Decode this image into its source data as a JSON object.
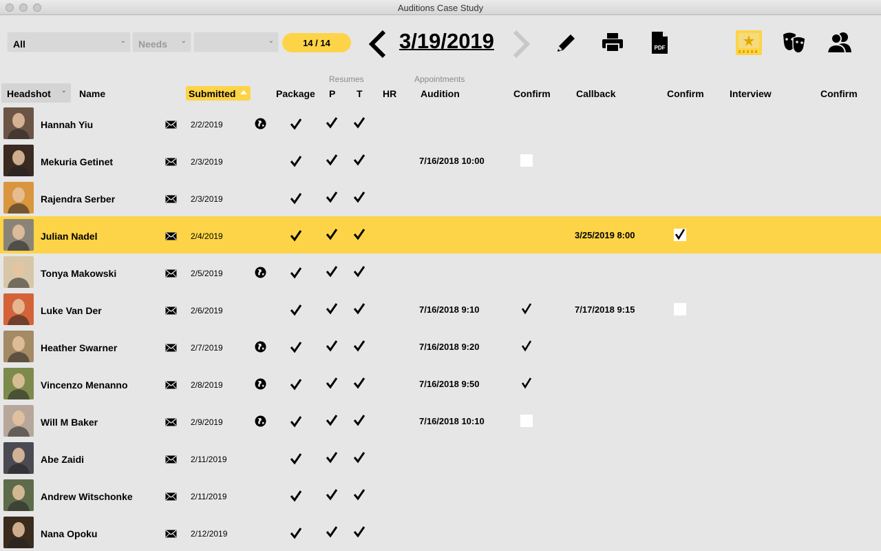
{
  "window": {
    "title": "Auditions Case Study"
  },
  "toolbar": {
    "filter_all": "All",
    "filter_needs": "Needs",
    "filter_third": "",
    "record_count": "14 / 14",
    "current_date": "3/19/2019",
    "icons": [
      "prev-arrow-icon",
      "next-arrow-icon",
      "pencil-icon",
      "printer-icon",
      "pdf-icon",
      "star-stage-icon",
      "theater-masks-icon",
      "people-icon"
    ],
    "accent_color": "#fdd447"
  },
  "headers": {
    "group_resumes": "Resumes",
    "group_appointments": "Appointments",
    "headshot": "Headshot",
    "name": "Name",
    "submitted": "Submitted",
    "package": "Package",
    "p": "P",
    "t": "T",
    "hr": "HR",
    "audition": "Audition",
    "confirm1": "Confirm",
    "callback": "Callback",
    "confirm2": "Confirm",
    "interview": "Interview",
    "confirm3": "Confirm"
  },
  "rows": [
    {
      "name": "Hannah Yiu",
      "submitted": "2/2/2019",
      "web": true,
      "package": true,
      "p": true,
      "t": true,
      "audition": "",
      "audition_confirm": null,
      "callback": "",
      "callback_confirm": null,
      "selected": false,
      "avatar_color": "#6b5446"
    },
    {
      "name": "Mekuria Getinet",
      "submitted": "2/3/2019",
      "web": false,
      "package": true,
      "p": true,
      "t": true,
      "audition": "7/16/2018 10:00",
      "audition_confirm": false,
      "callback": "",
      "callback_confirm": null,
      "selected": false,
      "avatar_color": "#3a2a22"
    },
    {
      "name": "Rajendra Serber",
      "submitted": "2/3/2019",
      "web": false,
      "package": true,
      "p": true,
      "t": true,
      "audition": "",
      "audition_confirm": null,
      "callback": "",
      "callback_confirm": null,
      "selected": false,
      "avatar_color": "#d9963f"
    },
    {
      "name": "Julian Nadel",
      "submitted": "2/4/2019",
      "web": false,
      "package": true,
      "p": true,
      "t": true,
      "audition": "",
      "audition_confirm": null,
      "callback": "3/25/2019 8:00",
      "callback_confirm": true,
      "selected": true,
      "avatar_color": "#8a8478"
    },
    {
      "name": "Tonya Makowski",
      "submitted": "2/5/2019",
      "web": true,
      "package": true,
      "p": true,
      "t": true,
      "audition": "",
      "audition_confirm": null,
      "callback": "",
      "callback_confirm": null,
      "selected": false,
      "avatar_color": "#d7c7a8"
    },
    {
      "name": "Luke Van Der",
      "submitted": "2/6/2019",
      "web": false,
      "package": true,
      "p": true,
      "t": true,
      "audition": "7/16/2018 9:10",
      "audition_confirm": true,
      "callback": "7/17/2018 9:15",
      "callback_confirm": false,
      "selected": false,
      "avatar_color": "#d5633a"
    },
    {
      "name": "Heather Swarner",
      "submitted": "2/7/2019",
      "web": true,
      "package": true,
      "p": true,
      "t": true,
      "audition": "7/16/2018 9:20",
      "audition_confirm": true,
      "callback": "",
      "callback_confirm": null,
      "selected": false,
      "avatar_color": "#a58a66"
    },
    {
      "name": "Vincenzo Menanno",
      "submitted": "2/8/2019",
      "web": true,
      "package": true,
      "p": true,
      "t": true,
      "audition": "7/16/2018 9:50",
      "audition_confirm": true,
      "callback": "",
      "callback_confirm": null,
      "selected": false,
      "avatar_color": "#7c8a4c"
    },
    {
      "name": "Will M Baker",
      "submitted": "2/9/2019",
      "web": true,
      "package": true,
      "p": true,
      "t": true,
      "audition": "7/16/2018 10:10",
      "audition_confirm": false,
      "callback": "",
      "callback_confirm": null,
      "selected": false,
      "avatar_color": "#b7a79a"
    },
    {
      "name": "Abe Zaidi",
      "submitted": "2/11/2019",
      "web": false,
      "package": true,
      "p": true,
      "t": true,
      "audition": "",
      "audition_confirm": null,
      "callback": "",
      "callback_confirm": null,
      "selected": false,
      "avatar_color": "#4a4a52"
    },
    {
      "name": "Andrew Witschonke",
      "submitted": "2/11/2019",
      "web": false,
      "package": true,
      "p": true,
      "t": true,
      "audition": "",
      "audition_confirm": null,
      "callback": "",
      "callback_confirm": null,
      "selected": false,
      "avatar_color": "#5d6b4a"
    },
    {
      "name": "Nana Opoku",
      "submitted": "2/12/2019",
      "web": false,
      "package": true,
      "p": true,
      "t": true,
      "audition": "",
      "audition_confirm": null,
      "callback": "",
      "callback_confirm": null,
      "selected": false,
      "avatar_color": "#3b2a1e"
    }
  ]
}
